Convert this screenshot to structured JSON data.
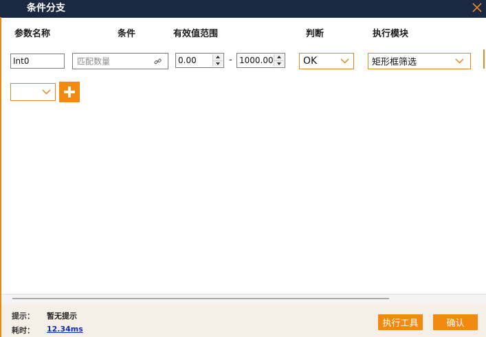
{
  "window": {
    "title": "条件分支"
  },
  "headers": {
    "param_name": "参数名称",
    "condition": "条件",
    "valid_range": "有效值范围",
    "judge": "判断",
    "exec_module": "执行模块"
  },
  "row": {
    "param_name_value": "Int0",
    "condition_placeholder": "匹配数量",
    "range_min": "0.00",
    "range_separator": "-",
    "range_max": "1000.00",
    "judge_value": "OK",
    "exec_module_value": "矩形框筛选"
  },
  "new_row": {
    "select_value": ""
  },
  "footer": {
    "hint_label": "提示：",
    "hint_value": "暂无提示",
    "time_label": "耗时：",
    "time_value": "12.34ms",
    "exec_tool_label": "执行工具",
    "confirm_label": "确认"
  },
  "colors": {
    "accent": "#F18A0F",
    "titlebar": "#1A2842"
  }
}
